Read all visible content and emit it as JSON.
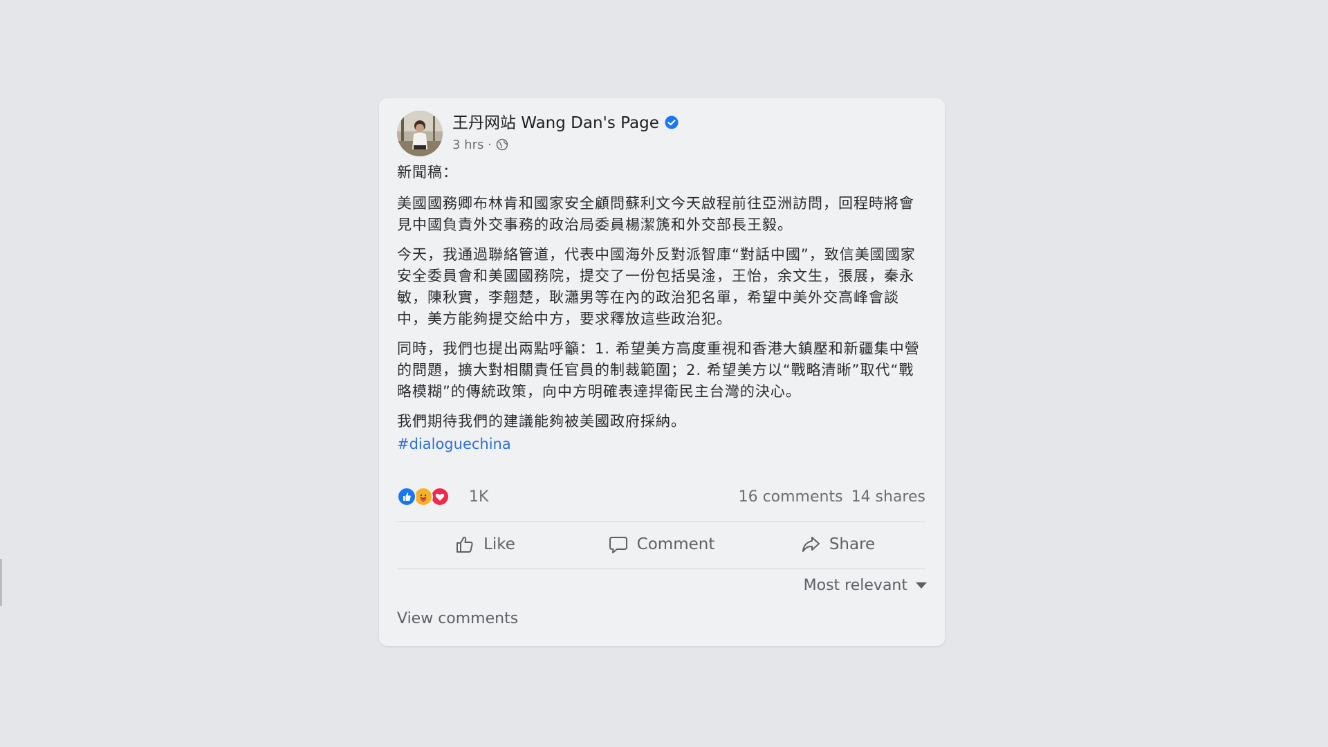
{
  "post": {
    "page_name": "王丹网站 Wang Dan's Page",
    "time": "3 hrs ·",
    "paragraphs": [
      "新聞稿：",
      "美國國務卿布林肯和國家安全顧問蘇利文今天啟程前往亞洲訪問，回程時將會見中國負責外交事務的政治局委員楊潔篪和外交部長王毅。",
      "今天，我通過聯絡管道，代表中國海外反對派智庫“對話中國”，致信美國國家安全委員會和美國國務院，提交了一份包括吳淦，王怡，余文生，張展，秦永敏，陳秋實，李翹楚，耿瀟男等在內的政治犯名單，希望中美外交高峰會談中，美方能夠提交給中方，要求釋放這些政治犯。",
      "同時，我們也提出兩點呼籲：1. 希望美方高度重視和香港大鎮壓和新疆集中營的問題，擴大對相關責任官員的制裁範圍；2. 希望美方以“戰略清晰”取代“戰略模糊”的傳統政策，向中方明確表達捍衛民主台灣的決心。",
      "我們期待我們的建議能夠被美國政府採納。"
    ],
    "hashtag": "#dialoguechina",
    "reactions": {
      "types": [
        "like",
        "care",
        "love"
      ],
      "count": "1K"
    },
    "comments": "16 comments",
    "shares": "14 shares",
    "actions": {
      "like": "Like",
      "comment": "Comment",
      "share": "Share"
    },
    "sort_label": "Most relevant",
    "view_comments": "View comments"
  },
  "colors": {
    "background": "#e4e6e9",
    "card": "#f0f1f3",
    "link": "#2f6fd6",
    "verified": "#1877f2",
    "like": "#1877f2",
    "love": "#f02849",
    "care": "#f7b125"
  }
}
